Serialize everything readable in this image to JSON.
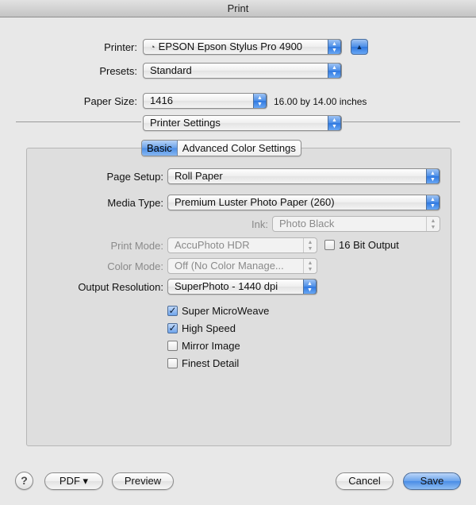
{
  "window": {
    "title": "Print"
  },
  "printer": {
    "label": "Printer:",
    "value": "EPSON Epson Stylus Pro 4900",
    "disclosure_icon": "triangle-up-icon"
  },
  "presets": {
    "label": "Presets:",
    "value": "Standard"
  },
  "paper_size": {
    "label": "Paper Size:",
    "value": "1416",
    "dimensions": "16.00 by 14.00 inches"
  },
  "section": {
    "value": "Printer Settings"
  },
  "tabs": [
    {
      "label": "Basic",
      "selected": true
    },
    {
      "label": "Advanced Color Settings",
      "selected": false
    }
  ],
  "settings": {
    "page_setup": {
      "label": "Page Setup:",
      "value": "Roll Paper"
    },
    "media_type": {
      "label": "Media Type:",
      "value": "Premium Luster Photo Paper (260)"
    },
    "ink": {
      "label": "Ink:",
      "value": "Photo Black",
      "enabled": false
    },
    "print_mode": {
      "label": "Print Mode:",
      "value": "AccuPhoto HDR",
      "enabled": false
    },
    "bit_output": {
      "label": "16 Bit Output",
      "checked": false
    },
    "color_mode": {
      "label": "Color Mode:",
      "value": "Off (No Color Manage...",
      "enabled": false
    },
    "output_resolution": {
      "label": "Output Resolution:",
      "value": "SuperPhoto - 1440 dpi"
    }
  },
  "options": [
    {
      "label": "Super MicroWeave",
      "checked": true
    },
    {
      "label": "High Speed",
      "checked": true
    },
    {
      "label": "Mirror Image",
      "checked": false
    },
    {
      "label": "Finest Detail",
      "checked": false
    }
  ],
  "footer": {
    "help": "?",
    "pdf": "PDF ▾",
    "preview": "Preview",
    "cancel": "Cancel",
    "save": "Save"
  },
  "glyphs": {
    "check": "✓",
    "popup_arrows": "▲▼",
    "disclosure": "▲",
    "printer_icon": "◔"
  },
  "colors": {
    "accent": "#4a8de6",
    "window_bg": "#e8e8e8",
    "panel_bg": "#dedede"
  }
}
